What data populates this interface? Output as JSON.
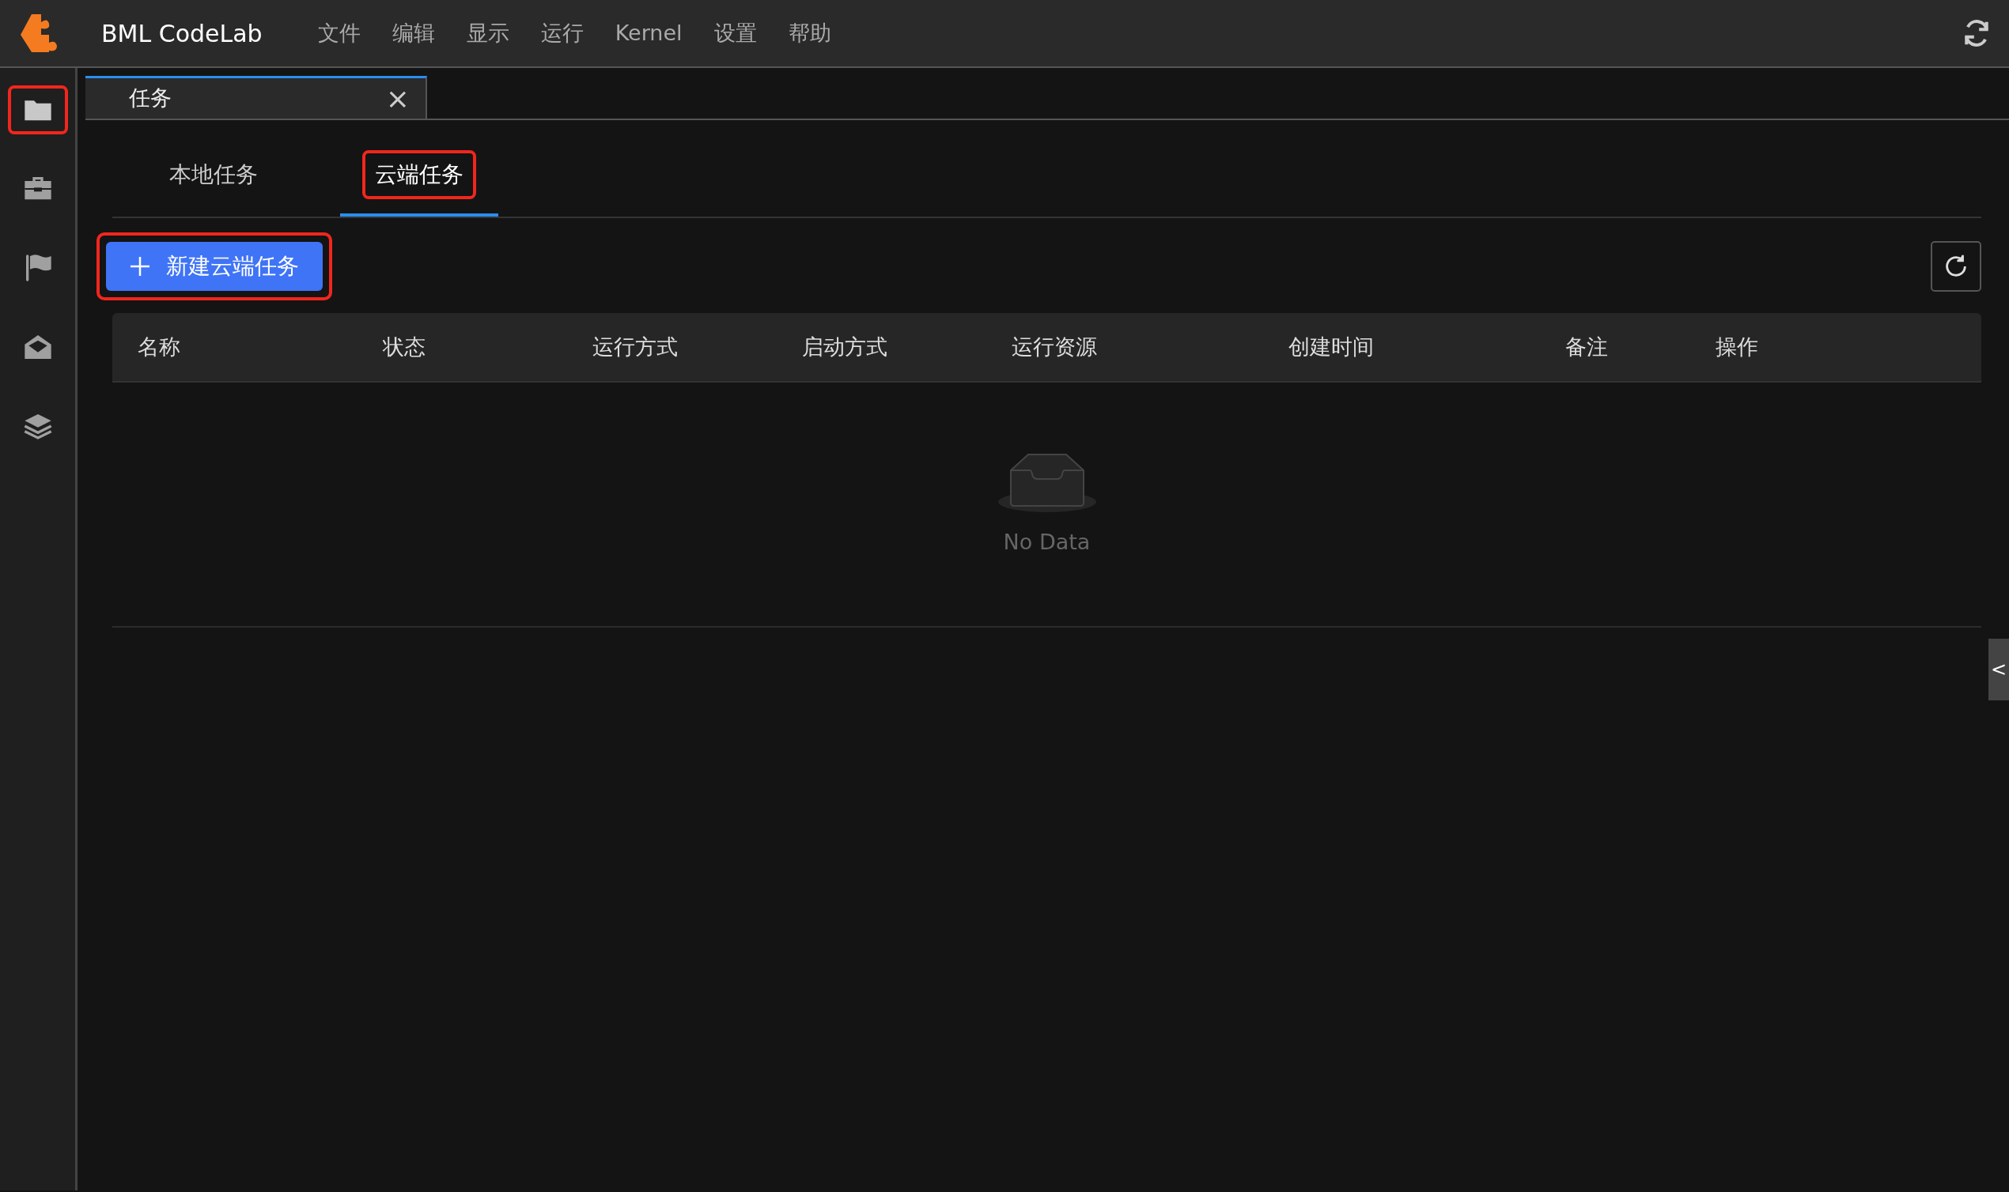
{
  "app": {
    "title": "BML CodeLab"
  },
  "menu": [
    "文件",
    "编辑",
    "显示",
    "运行",
    "Kernel",
    "设置",
    "帮助"
  ],
  "sidebar": {
    "items": [
      {
        "selected": true,
        "highlighted": true
      },
      {
        "selected": false,
        "highlighted": false
      },
      {
        "selected": false,
        "highlighted": false
      },
      {
        "selected": false,
        "highlighted": false
      },
      {
        "selected": false,
        "highlighted": false
      }
    ]
  },
  "document_tabs": [
    {
      "label": "任务",
      "selected": true,
      "close": "×"
    }
  ],
  "tabs": [
    {
      "label": "本地任务",
      "selected": false,
      "highlighted": false
    },
    {
      "label": "云端任务",
      "selected": true,
      "highlighted": true
    }
  ],
  "new_button": {
    "label": "新建云端任务",
    "highlighted": true
  },
  "table": {
    "columns": [
      "名称",
      "状态",
      "运行方式",
      "启动方式",
      "运行资源",
      "创建时间",
      "备注",
      "操作"
    ],
    "empty_text": "No Data"
  },
  "collapse_handle": "<"
}
